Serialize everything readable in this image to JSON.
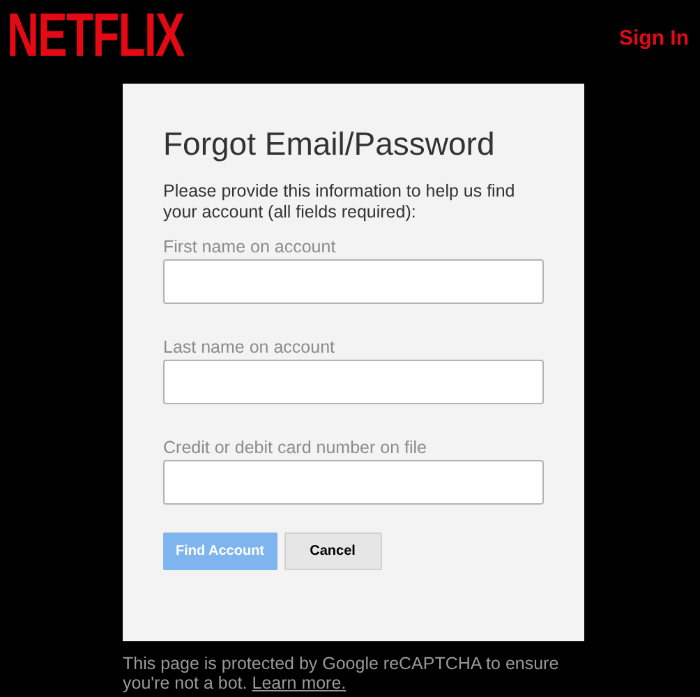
{
  "header": {
    "logo": "NETFLIX",
    "sign_in": "Sign In"
  },
  "form": {
    "title": "Forgot Email/Password",
    "intro": "Please provide this information to help us find your account (all fields required):",
    "fields": [
      {
        "label": "First name on account"
      },
      {
        "label": "Last name on account"
      },
      {
        "label": "Credit or debit card number on file"
      }
    ],
    "buttons": [
      {
        "label": "Find Account",
        "kind": "primary",
        "disabled": true
      },
      {
        "label": "Cancel",
        "kind": "secondary",
        "disabled": false
      }
    ]
  },
  "footer": {
    "text": "This page is protected by Google reCAPTCHA to ensure you're not a bot.",
    "link": "Learn more."
  }
}
